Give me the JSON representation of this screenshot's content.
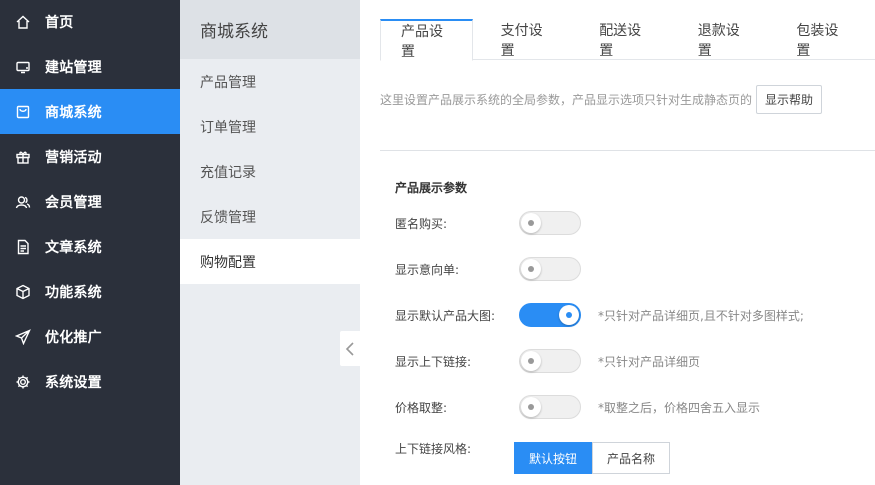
{
  "nav": {
    "items": [
      {
        "label": "首页",
        "icon": "home-icon"
      },
      {
        "label": "建站管理",
        "icon": "monitor-icon"
      },
      {
        "label": "商城系统",
        "icon": "shop-icon"
      },
      {
        "label": "营销活动",
        "icon": "gift-icon"
      },
      {
        "label": "会员管理",
        "icon": "users-icon"
      },
      {
        "label": "文章系统",
        "icon": "document-icon"
      },
      {
        "label": "功能系统",
        "icon": "cube-icon"
      },
      {
        "label": "优化推广",
        "icon": "send-icon"
      },
      {
        "label": "系统设置",
        "icon": "gear-icon"
      }
    ],
    "active": "商城系统"
  },
  "sub": {
    "title": "商城系统",
    "items": [
      "产品管理",
      "订单管理",
      "充值记录",
      "反馈管理",
      "购物配置"
    ],
    "active": "购物配置"
  },
  "tabs": [
    "产品设置",
    "支付设置",
    "配送设置",
    "退款设置",
    "包装设置"
  ],
  "notice": {
    "text": "这里设置产品展示系统的全局参数，产品显示选项只针对生成静态页的",
    "help_label": "显示帮助"
  },
  "section": {
    "title": "产品展示参数",
    "rows": [
      {
        "label": "匿名购买:",
        "on": false,
        "note": ""
      },
      {
        "label": "显示意向单:",
        "on": false,
        "note": ""
      },
      {
        "label": "显示默认产品大图:",
        "on": true,
        "note": "*只针对产品详细页,且不针对多图样式;"
      },
      {
        "label": "显示上下链接:",
        "on": false,
        "note": "*只针对产品详细页"
      },
      {
        "label": "价格取整:",
        "on": false,
        "note": "*取整之后，价格四舍五入显示"
      }
    ],
    "link_style": {
      "label": "上下链接风格:",
      "options": [
        "默认按钮",
        "产品名称"
      ],
      "selected": "默认按钮"
    }
  },
  "colors": {
    "accent": "#2a8df4",
    "sidebar": "#2b303b"
  }
}
